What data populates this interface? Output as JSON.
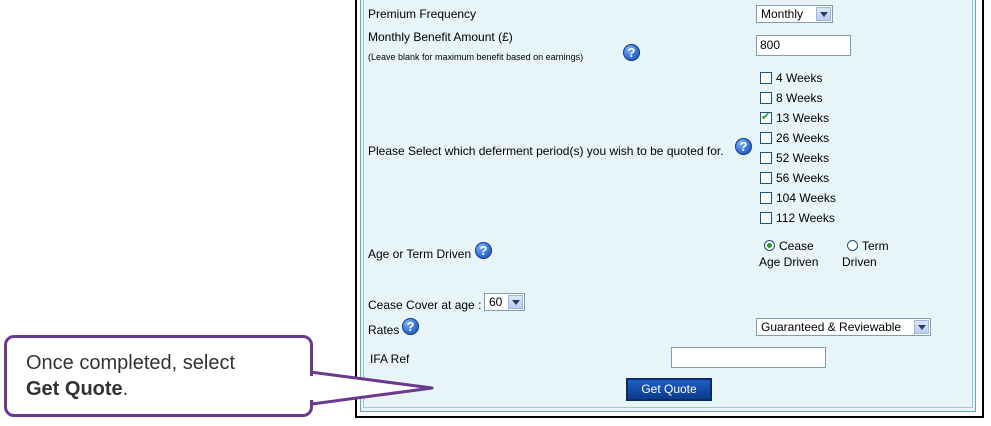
{
  "form": {
    "premium_frequency": {
      "label": "Premium Frequency",
      "value": "Monthly"
    },
    "monthly_benefit": {
      "label": "Monthly Benefit Amount (£)",
      "hint": "(Leave blank for maximum benefit based on earnings)",
      "value": "800"
    },
    "deferment": {
      "label": "Please Select which deferment period(s) you wish to be quoted for.",
      "options": [
        {
          "label": "4 Weeks",
          "checked": false
        },
        {
          "label": "8 Weeks",
          "checked": false
        },
        {
          "label": "13 Weeks",
          "checked": true
        },
        {
          "label": "26 Weeks",
          "checked": false
        },
        {
          "label": "52 Weeks",
          "checked": false
        },
        {
          "label": "56 Weeks",
          "checked": false
        },
        {
          "label": "104 Weeks",
          "checked": false
        },
        {
          "label": "112 Weeks",
          "checked": false
        }
      ]
    },
    "age_or_term": {
      "label": "Age or Term Driven",
      "options": [
        {
          "line1": "Cease",
          "line2": "Age Driven",
          "selected": true
        },
        {
          "line1": "Term",
          "line2": "Driven",
          "selected": false
        }
      ]
    },
    "cease_cover": {
      "label": "Cease Cover at age :",
      "value": "60"
    },
    "rates": {
      "label": "Rates",
      "value": "Guaranteed & Reviewable"
    },
    "ifa_ref": {
      "label": "IFA Ref",
      "value": ""
    },
    "submit_label": "Get Quote"
  },
  "callout": {
    "line1": "Once completed, select",
    "bold": "Get Quote",
    "suffix": "."
  },
  "colors": {
    "frame_bg": "#e8f5f8",
    "button": "#1f5fc3",
    "callout_border": "#6b3a8f",
    "check": "#21a121"
  },
  "icons": {
    "help": "help-icon"
  }
}
